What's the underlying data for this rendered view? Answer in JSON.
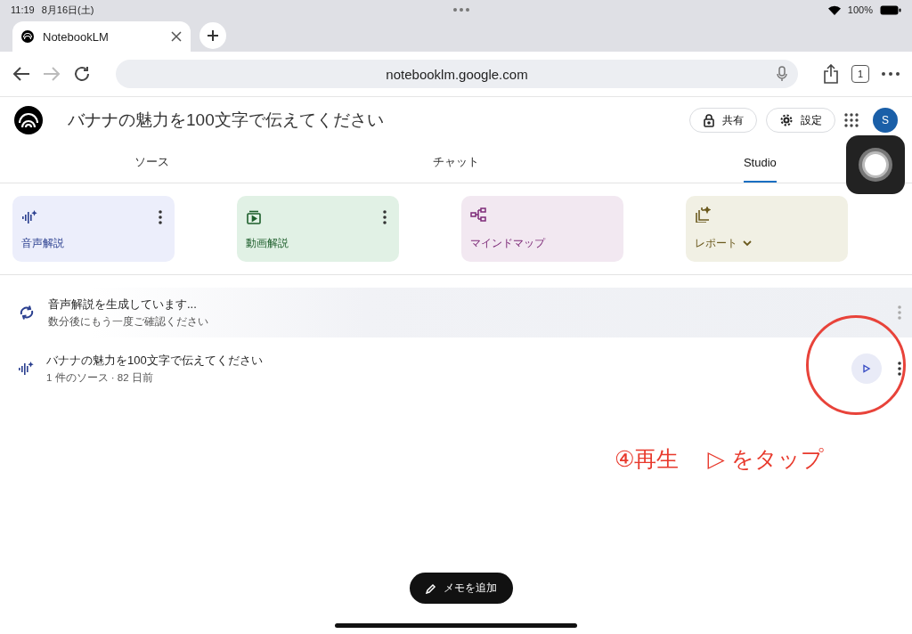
{
  "status_bar": {
    "time": "11:19",
    "date": "8月16日(土)",
    "battery": "100%"
  },
  "browser": {
    "tab_title": "NotebookLM",
    "url": "notebooklm.google.com",
    "tab_count": "1"
  },
  "header": {
    "title": "バナナの魅力を100文字で伝えてください",
    "buttons": [
      {
        "label": "共有",
        "kind": "lock"
      },
      {
        "label": "設定",
        "kind": "gear"
      }
    ],
    "avatar": "S"
  },
  "tabs": [
    {
      "label": "ソース",
      "selected": false
    },
    {
      "label": "チャット",
      "selected": false
    },
    {
      "label": "Studio",
      "selected": true
    }
  ],
  "cards": [
    {
      "label": "音声解説",
      "kind": "audio",
      "color": "#eceefb",
      "menu": true,
      "dropdown": false
    },
    {
      "label": "動画解説",
      "kind": "video",
      "color": "#e1f1e5",
      "menu": true,
      "dropdown": false
    },
    {
      "label": "マインドマップ",
      "kind": "mindmap",
      "color": "#f2e8f1",
      "menu": false,
      "dropdown": false
    },
    {
      "label": "レポート",
      "kind": "report",
      "color": "#f1f0e4",
      "menu": false,
      "dropdown": true
    }
  ],
  "items": [
    {
      "title": "音声解説を生成しています...",
      "subtitle": "数分後にもう一度ご確認ください",
      "kind": "generating",
      "playable": false
    },
    {
      "title": "バナナの魅力を100文字で伝えてください",
      "subtitle": "1 件のソース · 82 日前",
      "kind": "audio",
      "playable": true
    }
  ],
  "annotation": {
    "parts": [
      "④再生",
      "▷ をタップ"
    ]
  },
  "memo_button": "メモを追加"
}
